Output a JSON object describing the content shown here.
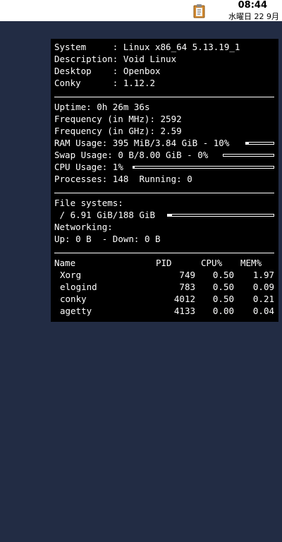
{
  "taskbar": {
    "clock_time": "08:44",
    "clock_date": "水曜日 22 9月",
    "tray_icon": "clipboard-icon"
  },
  "conky": {
    "system_label": "System     :",
    "system_value": "Linux x86_64 5.13.19_1",
    "description_label": "Description:",
    "description_value": "Void Linux",
    "desktop_label": "Desktop    :",
    "desktop_value": "Openbox",
    "conky_label": "Conky      :",
    "conky_value": "1.12.2",
    "uptime_label": "Uptime:",
    "uptime_value": "0h 26m 36s",
    "freq_mhz_label": "Frequency (in MHz):",
    "freq_mhz_value": "2592",
    "freq_ghz_label": "Frequency (in GHz):",
    "freq_ghz_value": "2.59",
    "ram_label": "RAM Usage:",
    "ram_value": "395 MiB/3.84 GiB - 10%",
    "ram_percent": 10,
    "swap_label": "Swap Usage:",
    "swap_value": "0 B/8.00 GiB - 0%",
    "swap_percent": 0,
    "cpu_label": "CPU Usage:",
    "cpu_value": "1%",
    "cpu_percent": 1,
    "processes_label": "Processes:",
    "processes_value": "148",
    "running_label": "Running:",
    "running_value": "0",
    "filesystems_label": "File systems:",
    "fs_root_label": " /",
    "fs_root_value": "6.91 GiB/188 GiB",
    "fs_root_percent": 4,
    "networking_label": "Networking:",
    "up_label": "Up:",
    "up_value": "0 B",
    "down_label": "- Down:",
    "down_value": "0 B",
    "proc_headers": {
      "name": "Name",
      "pid": "PID",
      "cpu": "CPU%",
      "mem": "MEM%"
    },
    "processes": [
      {
        "name": "Xorg",
        "pid": "749",
        "cpu": "0.50",
        "mem": "1.97"
      },
      {
        "name": "elogind",
        "pid": "783",
        "cpu": "0.50",
        "mem": "0.09"
      },
      {
        "name": "conky",
        "pid": "4012",
        "cpu": "0.50",
        "mem": "0.21"
      },
      {
        "name": "agetty",
        "pid": "4133",
        "cpu": "0.00",
        "mem": "0.04"
      }
    ]
  }
}
